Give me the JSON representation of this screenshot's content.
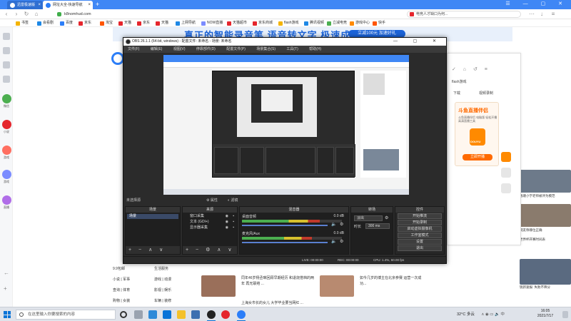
{
  "browser": {
    "tabs": [
      {
        "title": "迅雷极速版"
      },
      {
        "title": "网址大全-快速导航"
      }
    ],
    "url": "k8nomhud.com",
    "search_text": "电竞人才缺口为何...",
    "bookmarks": [
      "书签",
      "会看剧",
      "百度",
      "京东",
      "淘宝",
      "天猫",
      "京东",
      "天猫",
      "上网导航",
      "NOW直播",
      "天猫超市",
      "京东商城",
      "flash游戏",
      "腾讯视频",
      "立减电竞",
      "游戏中心",
      "快手"
    ]
  },
  "sidebar": {
    "apps": [
      {
        "label": "微信",
        "color": "#4caf50"
      },
      {
        "label": "小说",
        "color": "#e5262d"
      },
      {
        "label": "游戏",
        "color": "#ff6f61"
      },
      {
        "label": "游戏",
        "color": "#7b8cff"
      },
      {
        "label": "直播",
        "color": "#b06de8"
      }
    ]
  },
  "webpage": {
    "banner_text": "真正的智能录音笔  语音转文字  极速成稿",
    "banner_button": "立减100元 加速好礼",
    "left_links": [
      "9.9包邮",
      "生活服务",
      "小说 | 军事",
      "游戏 | 动漫",
      "查询 | 体育",
      "影视 | 娱乐",
      "购物 | 女装",
      "车辆 | 装修"
    ],
    "news": [
      "同年46岁杨丞琳回顾早期经历 和退烧搭档的两年 再无联络 ...",
      "如今几岁的博主在北京参赛 运营一次成功...",
      "上海女市长的女儿 大学毕业要当网红 ..."
    ],
    "right_captions": [
      "钱塘小学老师被评为模范",
      "网友称哪位正确",
      "世界杯开赛时间表",
      "锐新速报: 失败不降分"
    ]
  },
  "douyu": {
    "tabs": [
      "下载",
      "视频录制"
    ],
    "bookmark": "flash游戏",
    "title": "斗鱼直播伴侣",
    "subtitle": "斗鱼直播伴侣 电脑版 轻松开播 高清直播工具",
    "logo_text": "DOUYU",
    "button": "立即开播"
  },
  "obs": {
    "title": "OBS 26.1.1 (64-bit, windows) - 配置文件: 未命名 - 场景: 未命名",
    "menu": [
      "文件(F)",
      "编辑(E)",
      "视图(V)",
      "停靠部件(D)",
      "配置文件(P)",
      "场景集合(S)",
      "工具(T)",
      "帮助(H)"
    ],
    "docks_label": "未选择源",
    "properties": "属性",
    "filters": "滤镜",
    "scenes_header": "场景",
    "sources_header": "来源",
    "mixer_header": "混音器",
    "transitions_header": "转场",
    "controls_header": "控件",
    "scene_items": [
      "场景"
    ],
    "source_items": [
      "窗口采集",
      "文本 (GDI+)",
      "显示器采集"
    ],
    "mixer_channels": [
      {
        "name": "桌面音频",
        "db": "0.0 dB",
        "level": 0.78
      },
      {
        "name": "麦克风/Aux",
        "db": "0.0 dB",
        "level": 0.7
      }
    ],
    "transition": "淡出",
    "duration_label": "时长",
    "duration_value": "300 ms",
    "controls": [
      "开始推流",
      "开始录制",
      "启动虚拟摄像机",
      "工作室模式",
      "设置",
      "退出"
    ],
    "status": {
      "live": "LIVE: 00:00:00",
      "rec": "REC: 00:00:00",
      "cpu": "CPU: 1.4%, 60.00 fps"
    }
  },
  "taskbar": {
    "search_placeholder": "在这里输入你要搜索的内容",
    "weather": "32°C 多云",
    "time": "16:05",
    "date": "2021/7/17"
  }
}
